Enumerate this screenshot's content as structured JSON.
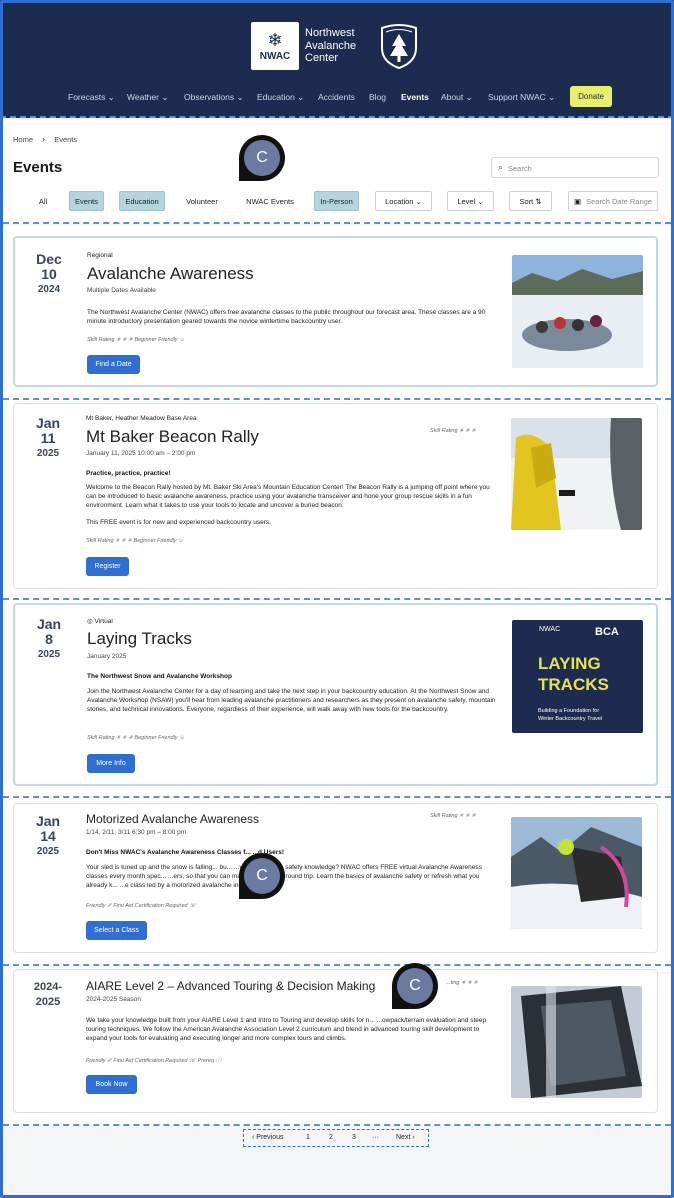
{
  "header": {
    "logo_text": "NWAC",
    "brand_line1": "Northwest",
    "brand_line2": "Avalanche",
    "brand_line3": "Center",
    "nav": [
      "Forecasts ⌄",
      "Weather ⌄",
      "Observations ⌄",
      "Education ⌄",
      "Accidents",
      "Blog",
      "Events",
      "About ⌄",
      "Support NWAC ⌄"
    ],
    "donate": "Donate"
  },
  "breadcrumb": {
    "home": "Home",
    "sep": "›",
    "current": "Events"
  },
  "page_title": "Events",
  "search": {
    "placeholder": "Search"
  },
  "filters": {
    "all": "All",
    "events": "Events",
    "education": "Education",
    "volunteer": "Volunteer",
    "nwac": "NWAC Events",
    "inperson": "In-Person",
    "location": "Location ⌄",
    "level": "Level ⌄",
    "sort": "Sort ⇅",
    "daterange": "Search Date Range"
  },
  "cards": [
    {
      "month": "Dec",
      "day": "10",
      "year": "2024",
      "loc": "Regional",
      "title": "Avalanche Awareness",
      "sub": "Multiple Dates Available",
      "lead": "",
      "desc": "The Northwest Avalanche Center (NWAC) offers free avalanche classes to the public throughout our forecast area. These classes are a 90 minute introductory presentation geared towards the novice wintertime backcountry user.",
      "desc2": "",
      "skill": "Skill Rating ✳ ✳ ✳     Beginner Friendly ☺",
      "skill_right": "",
      "button": "Find a Date"
    },
    {
      "month": "Jan",
      "day": "11",
      "year": "2025",
      "loc": "Mt Baker, Heather Meadow Base Area",
      "title": "Mt Baker Beacon Rally",
      "sub": "January 11, 2025  10:00 am – 2:00 pm",
      "lead": "Practice, practice, practice!",
      "desc": "Welcome to the Beacon Rally hosted by Mt. Baker Ski Area's Mountain Education Center! The Beacon Rally is a jumping off point where you can be introduced to basic avalanche awareness, practice using your avalanche transceiver and hone your group rescue skills in a fun environment. Learn what it takes to use your tools to locate and uncover a buried beacon.",
      "desc2": "This FREE event is for new and experienced backcountry users.",
      "skill": "Skill Rating ✳ ✳ ✳     Beginner Friendly ☺",
      "skill_right": "Skill Rating ✳ ✳ ✳",
      "button": "Register"
    },
    {
      "month": "Jan",
      "day": "8",
      "year": "2025",
      "loc": "◎ Virtual",
      "title": "Laying Tracks",
      "sub": "January 2025",
      "lead": "The Northwest Snow and Avalanche Workshop",
      "desc": "Join the Northwest Avalanche Center for a day of learning and take the next step in your backcountry education. At the Northwest Snow and Avalanche Workshop (NSAW) you'll hear from leading avalanche  practitioners and researchers as they present on avalanche safety,  mountain stories, and technical innovations. Everyone, regardless of their experience, will walk away with new tools for the backcountry.",
      "desc2": "",
      "skill": "Skill Rating ✳ ✳ ✳     Beginner Friendly ☺",
      "skill_right": "",
      "button": "More Info"
    },
    {
      "month": "Jan",
      "day": "14",
      "year": "2025",
      "loc": "",
      "title": "Motorized Avalanche Awareness",
      "sub": "1/14, 2/11, 3/11  6:30 pm – 8:00 pm",
      "lead": "Don't Miss NWAC's Avalanche Awareness Classes f...               ...d Users!",
      "desc": "Your sled is tuned up and the snow is falling... bu...                            ...your avalanche safety knowledge? NWAC offers FREE virtual Avalanche  Awareness classes every month spec...                         ...ers, so that you can make every ride a round trip. Learn the basics of avalanche safety or refresh what you already k...                     ...e class led by a  motorized avalanche instructor.",
      "desc2": "",
      "skill": "Friendly ✐     First Aid Certification Required ☏",
      "skill_right": "Skill Rating ✳ ✳ ✳",
      "button": "Select a Class"
    },
    {
      "month": "2024-",
      "day": "2025",
      "year": "",
      "loc": "",
      "title": "AIARE Level 2 – Advanced Touring & Decision Making",
      "sub": "2024-2025 Season",
      "lead": "",
      "desc": "We take your knowledge built from your AIARE Level 1 and Intro to Touring and develop skills for n...                    ...owpack/terrain evaluation and steep touring techniques. We follow the American Avalanche  Association Level 2 curriculum and blend in advanced touring skill development to expand your tools for evaluating and executing longer and more complex tours and climbs.",
      "desc2": "",
      "skill": "Friendly ✐     First Aid Certification Required ☏     Prereq ⓘ",
      "skill_right": "...ting ✳ ✳ ✳",
      "button": "Book Now"
    }
  ],
  "laying_tracks_img": {
    "brand1": "NWAC",
    "brand2": "BCA",
    "l1": "LAYING",
    "l2": "TRACKS",
    "tag1": "Building a Foundation for",
    "tag2": "Winter Backcountry Travel"
  },
  "pager": {
    "prev": "‹ Previous",
    "p1": "1",
    "p2": "2",
    "p3": "3",
    "dots": "···",
    "next": "Next ›"
  },
  "cursor_label": "C",
  "colors": {
    "header": "#1c2b4f",
    "accent": "#2f6fd1",
    "donate": "#e8f06a",
    "chip": "#b6d4de"
  }
}
